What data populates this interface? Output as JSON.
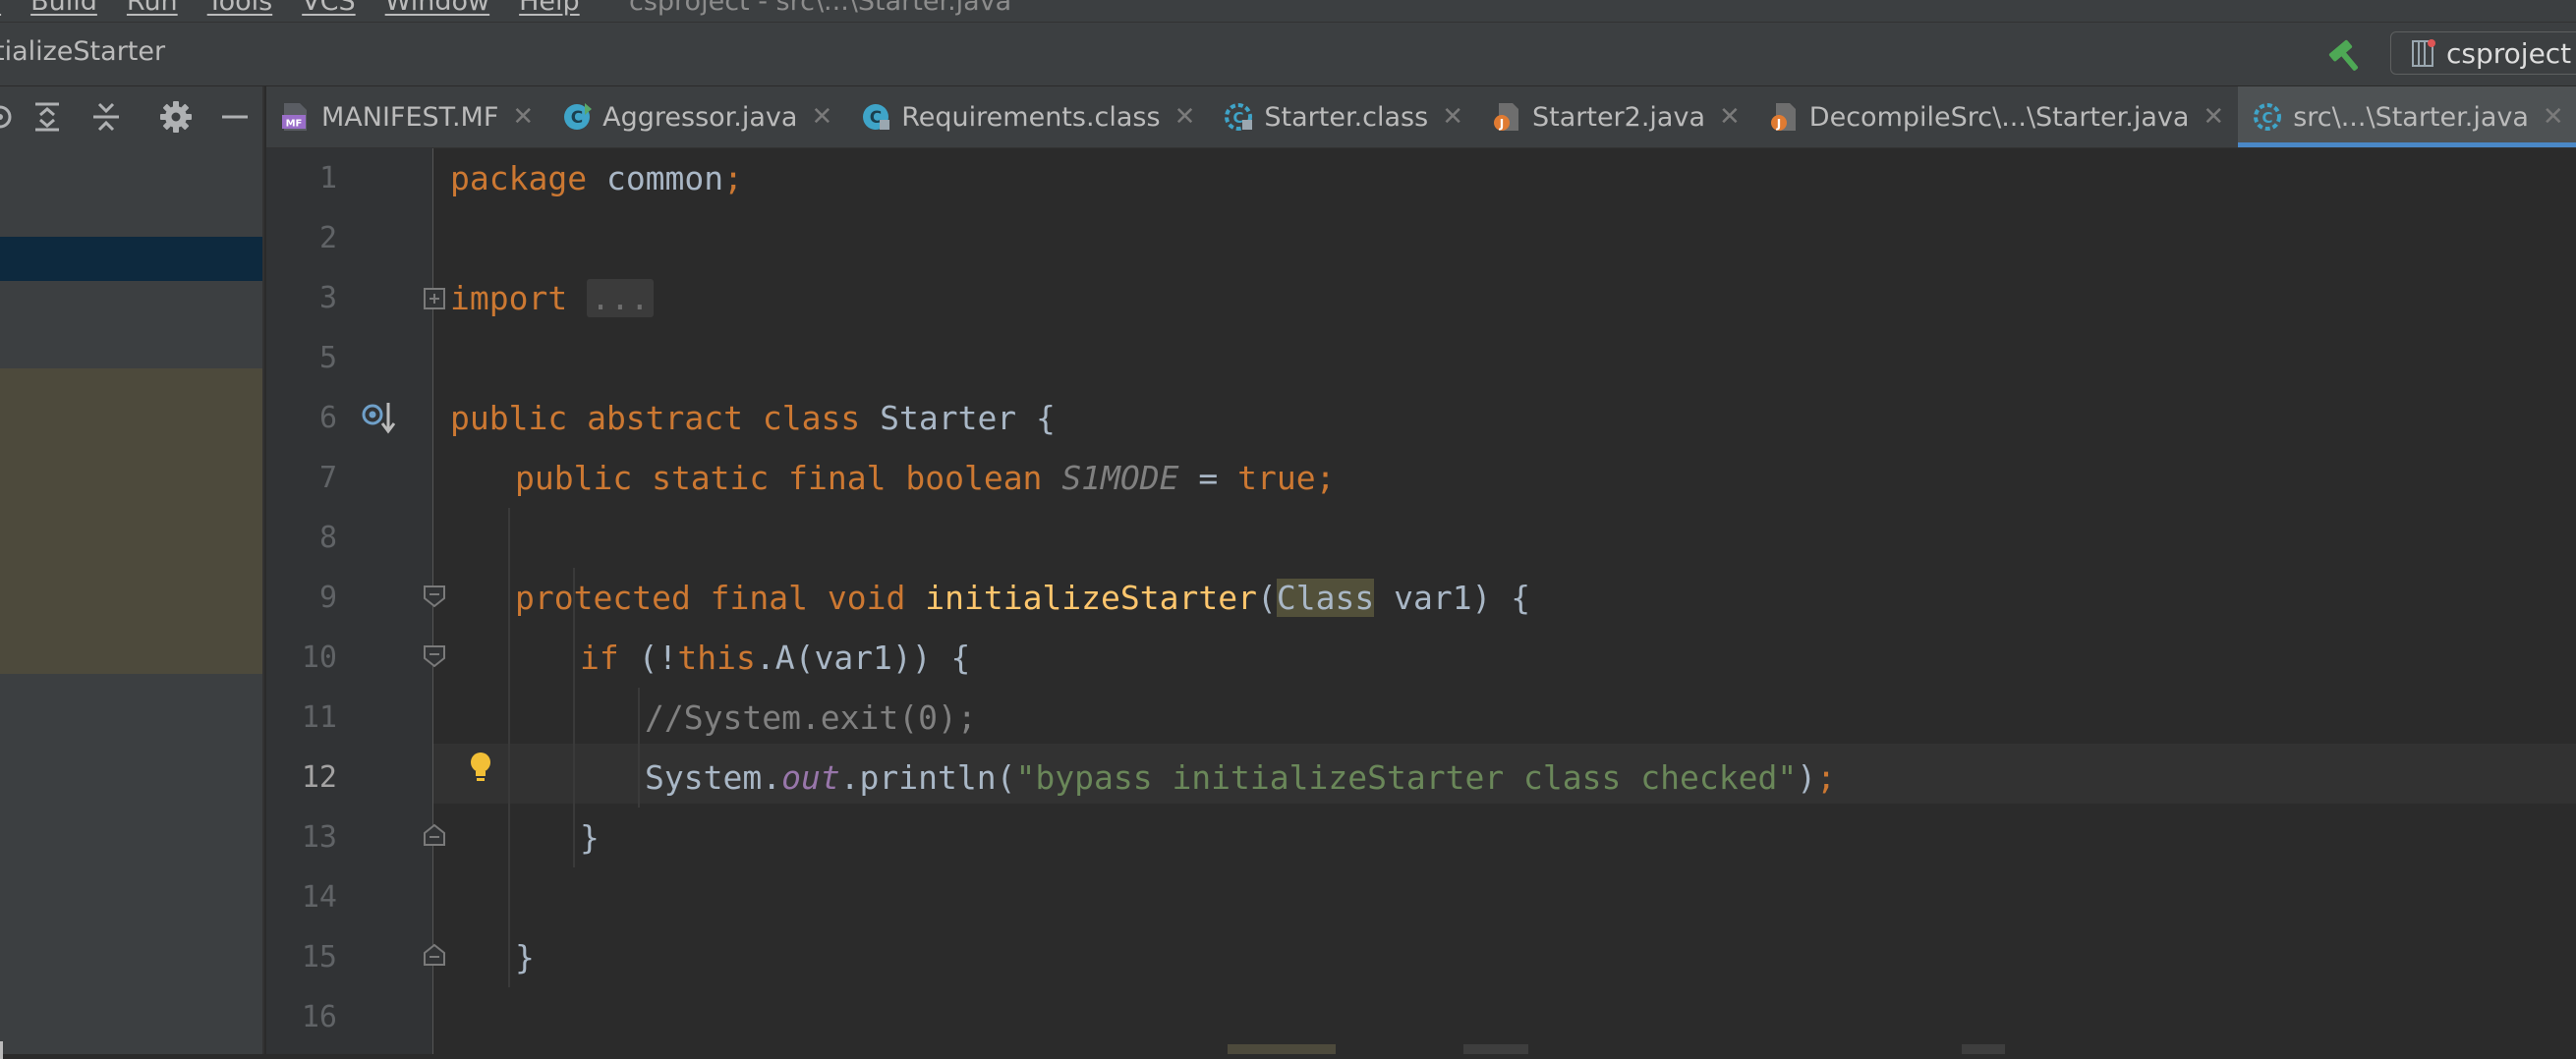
{
  "menu": {
    "items": [
      "r",
      "Build",
      "Run",
      "Tools",
      "VCS",
      "Window",
      "Help"
    ],
    "window_title": "csproject - src\\...\\Starter.java"
  },
  "breadcrumb": "tializeStarter",
  "run_config": {
    "label": "csproject"
  },
  "tabs": [
    {
      "label": "MANIFEST.MF",
      "icon": "manifest-file-icon",
      "active": false
    },
    {
      "label": "Aggressor.java",
      "icon": "java-class-icon",
      "active": false
    },
    {
      "label": "Requirements.class",
      "icon": "compiled-class-icon",
      "active": false
    },
    {
      "label": "Starter.class",
      "icon": "compiled-abstract-class-icon",
      "active": false
    },
    {
      "label": "Starter2.java",
      "icon": "java-file-icon",
      "active": false
    },
    {
      "label": "DecompileSrc\\...\\Starter.java",
      "icon": "java-file-icon",
      "active": false
    },
    {
      "label": "src\\...\\Starter.java",
      "icon": "abstract-class-icon",
      "active": true
    }
  ],
  "editor": {
    "current_line": "12",
    "line_numbers": [
      "1",
      "2",
      "3",
      "5",
      "6",
      "7",
      "8",
      "9",
      "10",
      "11",
      "12",
      "13",
      "14",
      "15",
      "16"
    ],
    "code": {
      "l1_kw": "package",
      "l1_rest": " common",
      "l1_semi": ";",
      "l3_kw": "import",
      "l3_fold": "...",
      "l6_kw": "public abstract class",
      "l6_rest": " Starter {",
      "l7_kw": "public static final boolean",
      "l7_field": "S1MODE",
      "l7_eq": " = ",
      "l7_val": "true",
      "l7_semi": ";",
      "l9_kw": "protected final void",
      "l9_fn": "initializeStarter",
      "l9_open": "(",
      "l9_type": "Class",
      "l9_rest": " var1) {",
      "l10_kw": "if",
      "l10_mid": " (!",
      "l10_this": "this",
      "l10_rest": ".A(var1)) {",
      "l11_comment": "//System.exit(0);",
      "l12_sys": "System.",
      "l12_out": "out",
      "l12_call": ".println(",
      "l12_str": "\"bypass initializeStarter class checked\"",
      "l12_close": ")",
      "l12_semi": ";",
      "l13": "}",
      "l15": "}"
    }
  },
  "colors": {
    "keyword": "#cc7832",
    "function": "#ffc66d",
    "string": "#6a8759",
    "comment": "#808080",
    "field": "#9876aa",
    "accent": "#4a88c7"
  }
}
